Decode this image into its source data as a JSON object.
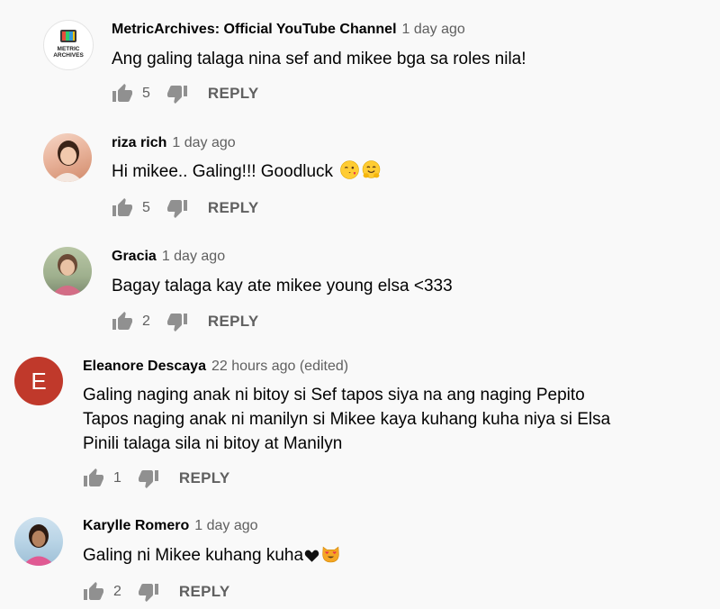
{
  "reply_label": "REPLY",
  "comments": [
    {
      "author": "MetricArchives: Official YouTube Channel",
      "time": "1 day ago",
      "lines": [
        "Ang galing talaga nina sef and mikee bga sa roles nila!"
      ],
      "likes": "5",
      "avatar_text": "METRIC ARCHIVES"
    },
    {
      "author": "riza rich",
      "time": "1 day ago",
      "lines": [
        "Hi mikee.. Galing!!! Goodluck"
      ],
      "likes": "5"
    },
    {
      "author": "Gracia",
      "time": "1 day ago",
      "lines": [
        "Bagay talaga kay ate mikee young elsa <333"
      ],
      "likes": "2"
    },
    {
      "author": "Eleanore Descaya",
      "time": "22 hours ago (edited)",
      "lines": [
        "Galing naging anak ni bitoy si Sef tapos siya na ang naging Pepito",
        "Tapos naging anak ni manilyn si Mikee kaya kuhang kuha niya si Elsa",
        "Pinili talaga sila ni bitoy at Manilyn"
      ],
      "likes": "1",
      "avatar_letter": "E",
      "avatar_color": "#c0392b"
    },
    {
      "author": "Karylle Romero",
      "time": "1 day ago",
      "lines": [
        "Galing ni Mikee kuhang kuha"
      ],
      "likes": "2"
    }
  ],
  "icons": {
    "like": "thumbs-up-icon",
    "dislike": "thumbs-down-icon",
    "emoji1": "winking-kiss-emoji",
    "emoji2": "hugging-face-emoji",
    "emoji3": "black-heart-emoji",
    "emoji4": "heart-eyes-cat-emoji"
  }
}
